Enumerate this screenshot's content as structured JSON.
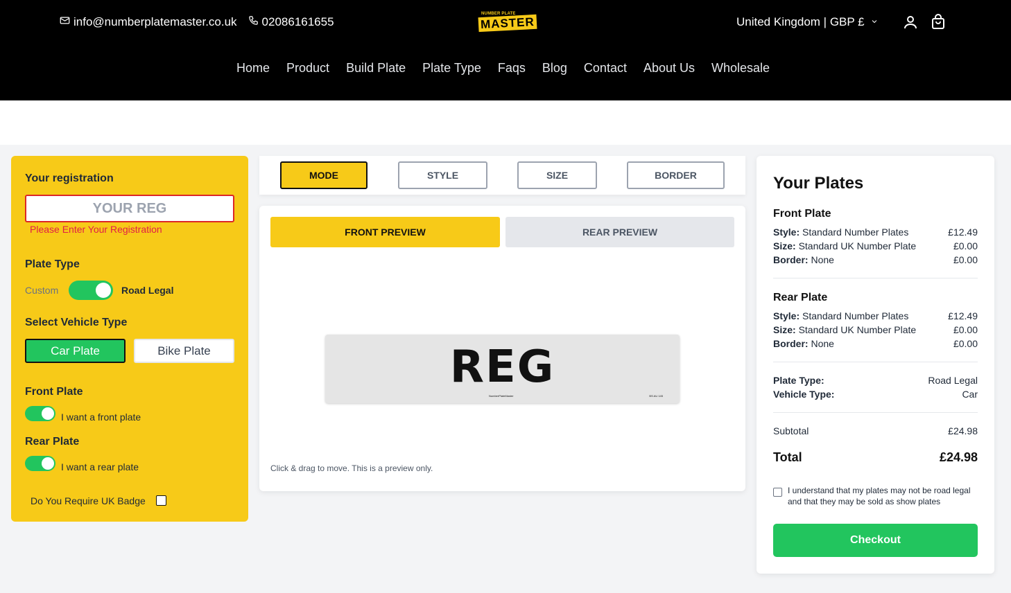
{
  "header": {
    "email": "info@numberplatemaster.co.uk",
    "phone": "02086161655",
    "logo_small": "NUMBER PLATE",
    "logo_big": "MASTER",
    "locale": "United Kingdom | GBP £",
    "icons": [
      "mail-icon",
      "phone-icon",
      "chevron-down-icon",
      "user-icon",
      "cart-icon"
    ]
  },
  "nav": [
    "Home",
    "Product",
    "Build Plate",
    "Plate Type",
    "Faqs",
    "Blog",
    "Contact",
    "About Us",
    "Wholesale"
  ],
  "left": {
    "reg_label": "Your registration",
    "reg_placeholder": "YOUR REG",
    "reg_error": "Please Enter Your Registration",
    "plate_type_label": "Plate Type",
    "custom_label": "Custom",
    "road_legal_label": "Road Legal",
    "vehicle_label": "Select Vehicle Type",
    "car_plate": "Car Plate",
    "bike_plate": "Bike Plate",
    "front_plate_label": "Front Plate",
    "front_plate_toggle": "I want a front plate",
    "rear_plate_label": "Rear Plate",
    "rear_plate_toggle": "I want a rear plate",
    "uk_badge_label": "Do You Require UK Badge"
  },
  "tabs": [
    "MODE",
    "STYLE",
    "SIZE",
    "BORDER"
  ],
  "preview": {
    "front": "FRONT PREVIEW",
    "rear": "REAR PREVIEW",
    "plate_text": "REG",
    "plate_mark": "NumberPlateMaster",
    "plate_bs": "BS AU 145",
    "note": "Click & drag to move. This is a preview only."
  },
  "summary": {
    "title": "Your Plates",
    "front_heading": "Front Plate",
    "rear_heading": "Rear Plate",
    "style_key": "Style:",
    "size_key": "Size:",
    "border_key": "Border:",
    "front": {
      "style": "Standard Number Plates",
      "style_price": "£12.49",
      "size": "Standard UK Number Plate",
      "size_price": "£0.00",
      "border": "None",
      "border_price": "£0.00"
    },
    "rear": {
      "style": "Standard Number Plates",
      "style_price": "£12.49",
      "size": "Standard UK Number Plate",
      "size_price": "£0.00",
      "border": "None",
      "border_price": "£0.00"
    },
    "plate_type_key": "Plate Type:",
    "plate_type_val": "Road Legal",
    "vehicle_type_key": "Vehicle Type:",
    "vehicle_type_val": "Car",
    "subtotal_key": "Subtotal",
    "subtotal_val": "£24.98",
    "total_key": "Total",
    "total_val": "£24.98",
    "agree_text": "I understand that my plates may not be road legal and that they may be sold as show plates",
    "checkout": "Checkout"
  }
}
